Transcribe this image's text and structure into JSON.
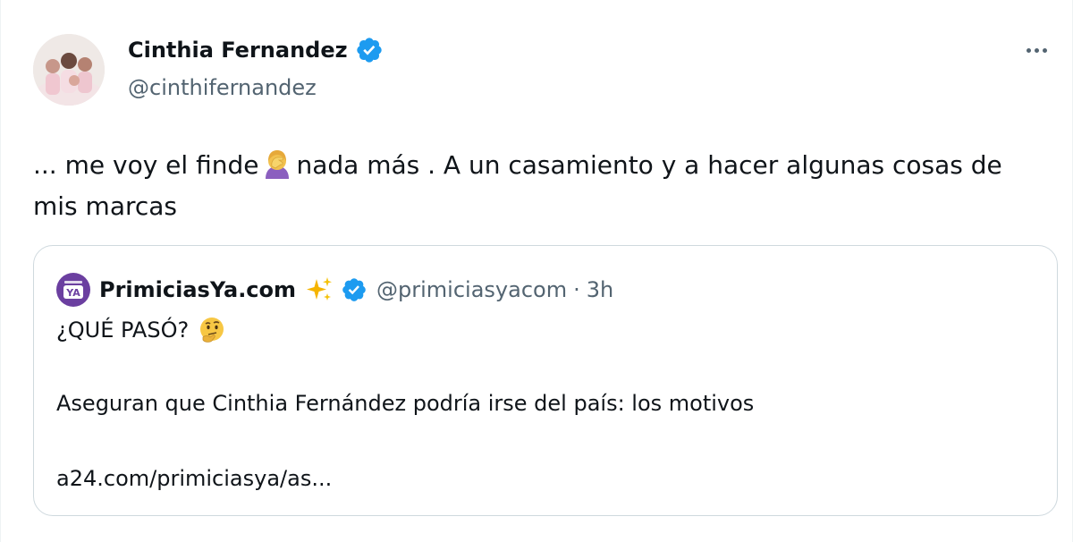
{
  "author": {
    "name": "Cinthia Fernandez",
    "handle": "@cinthifernandez",
    "verified_icon": "verified-badge-icon",
    "avatar_icon": "profile-photo"
  },
  "tweet": {
    "text_part1": "... me voy el finde",
    "emoji_1": "woman-facepalming-icon",
    "text_part2": "nada más . A un casamiento y a hacer algunas cosas de mis marcas"
  },
  "quoted_tweet": {
    "account_name": "PrimiciasYa.com",
    "account_handle": "@primiciasyacom",
    "separator": "·",
    "time": "3h",
    "logo_text": "YA",
    "line1": "¿QUÉ PASÓ?",
    "emoji_2": "thinking-face-icon",
    "line2": "Aseguran que Cinthia Fernández podría irse del país: los motivos",
    "link": "a24.com/primiciasya/as..."
  },
  "colors": {
    "verified_blue": "#1d9bf0",
    "logo_purple": "#6b3fa0",
    "secondary_text": "#536471",
    "border": "#cfd9de"
  }
}
